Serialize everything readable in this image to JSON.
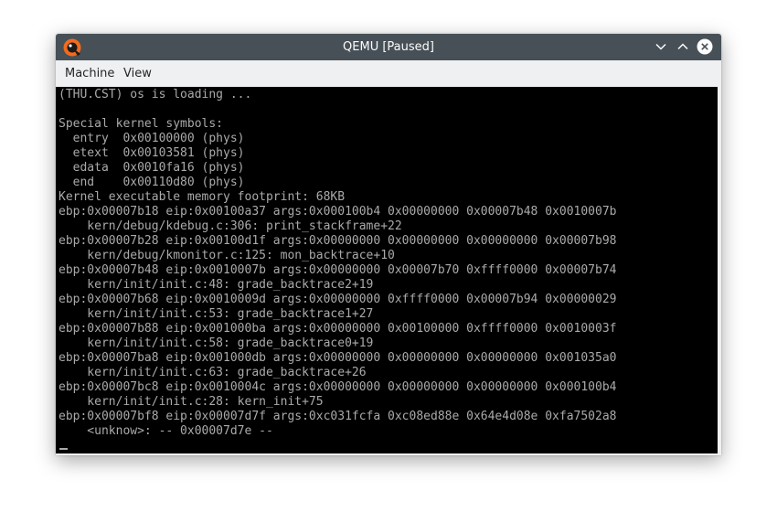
{
  "window": {
    "title": "QEMU [Paused]",
    "icons": {
      "app": "qemu-logo-icon",
      "minimize": "chevron-down-icon",
      "maximize": "chevron-up-icon",
      "close": "close-icon"
    }
  },
  "menubar": {
    "items": [
      "Machine",
      "View"
    ]
  },
  "console": {
    "lines": [
      "(THU.CST) os is loading ...",
      "",
      "Special kernel symbols:",
      "  entry  0x00100000 (phys)",
      "  etext  0x00103581 (phys)",
      "  edata  0x0010fa16 (phys)",
      "  end    0x00110d80 (phys)",
      "Kernel executable memory footprint: 68KB",
      "ebp:0x00007b18 eip:0x00100a37 args:0x000100b4 0x00000000 0x00007b48 0x0010007b",
      "    kern/debug/kdebug.c:306: print_stackframe+22",
      "ebp:0x00007b28 eip:0x00100d1f args:0x00000000 0x00000000 0x00000000 0x00007b98",
      "    kern/debug/kmonitor.c:125: mon_backtrace+10",
      "ebp:0x00007b48 eip:0x0010007b args:0x00000000 0x00007b70 0xffff0000 0x00007b74",
      "    kern/init/init.c:48: grade_backtrace2+19",
      "ebp:0x00007b68 eip:0x0010009d args:0x00000000 0xffff0000 0x00007b94 0x00000029",
      "    kern/init/init.c:53: grade_backtrace1+27",
      "ebp:0x00007b88 eip:0x001000ba args:0x00000000 0x00100000 0xffff0000 0x0010003f",
      "    kern/init/init.c:58: grade_backtrace0+19",
      "ebp:0x00007ba8 eip:0x001000db args:0x00000000 0x00000000 0x00000000 0x001035a0",
      "    kern/init/init.c:63: grade_backtrace+26",
      "ebp:0x00007bc8 eip:0x0010004c args:0x00000000 0x00000000 0x00000000 0x000100b4",
      "    kern/init/init.c:28: kern_init+75",
      "ebp:0x00007bf8 eip:0x00007d7f args:0xc031fcfa 0xc08ed88e 0x64e4d08e 0xfa7502a8",
      "    <unknow>: -- 0x00007d7e --"
    ]
  },
  "colors": {
    "titlebar": "#475057",
    "menubar": "#eff0f1",
    "screen": "#000000",
    "console_text": "#aaaaaa",
    "close_button": "#fcfcfc"
  }
}
